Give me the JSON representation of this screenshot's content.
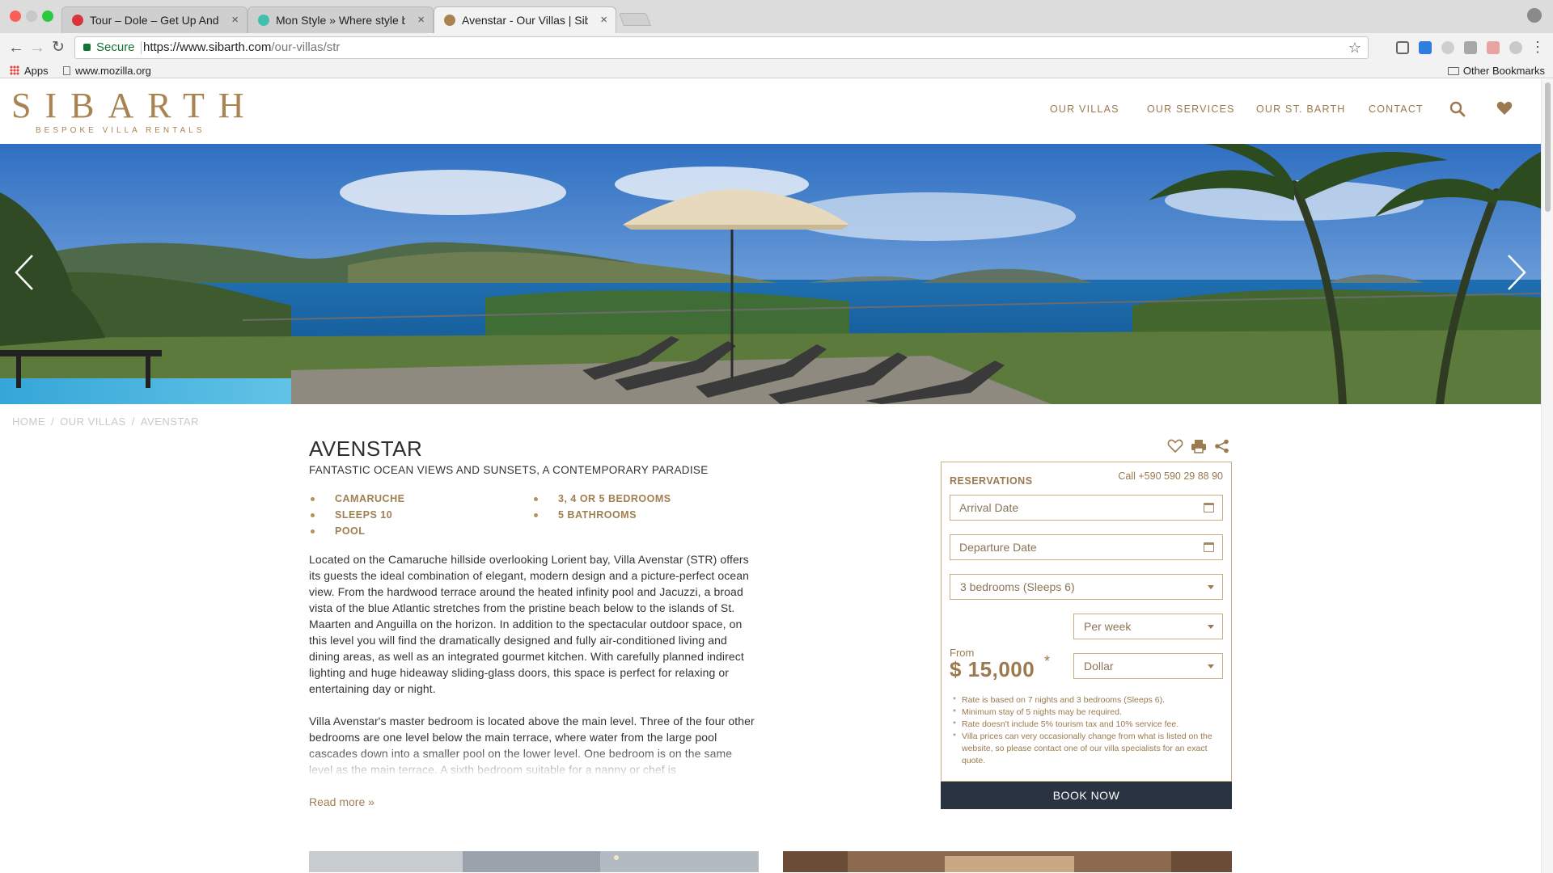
{
  "browser": {
    "tabs": [
      {
        "title": "Tour – Dole – Get Up And Grow",
        "active": false
      },
      {
        "title": "Mon Style » Where style beco",
        "active": false
      },
      {
        "title": "Avenstar - Our Villas | Sibarth",
        "active": true
      }
    ],
    "tab_close_glyph": "×",
    "secure_label": "Secure",
    "url_host": "https://www.sibarth.com",
    "url_path": "/our-villas/str",
    "bookmarks": [
      "Apps",
      "www.mozilla.org"
    ],
    "other_bookmarks": "Other Bookmarks"
  },
  "site": {
    "logo_word": "SIBARTH",
    "logo_tagline": "BESPOKE VILLA RENTALS",
    "nav": [
      "OUR VILLAS",
      "OUR SERVICES",
      "OUR ST. BARTH",
      "CONTACT"
    ],
    "accent_color": "#a07f50",
    "breadcrumb": [
      "HOME",
      "OUR VILLAS",
      "AVENSTAR"
    ],
    "breadcrumb_sep": "/"
  },
  "villa": {
    "name": "AVENSTAR",
    "tagline": "FANTASTIC OCEAN VIEWS AND SUNSETS, A CONTEMPORARY PARADISE",
    "features_left": [
      "CAMARUCHE",
      "SLEEPS 10",
      "POOL"
    ],
    "features_right": [
      "3, 4 OR 5 BEDROOMS",
      "5 BATHROOMS"
    ],
    "description": [
      "Located on the Camaruche hillside overlooking Lorient bay, Villa Avenstar (STR) offers its guests the ideal combination of elegant, modern design and a picture-perfect ocean view. From the hardwood terrace around the heated infinity pool and Jacuzzi, a broad vista of the blue Atlantic stretches from the pristine beach below to the islands of St. Maarten and Anguilla on the horizon. In addition to the spectacular outdoor space, on this level you will find the dramatically designed and fully air-conditioned living and dining areas, as well as an integrated gourmet kitchen. With carefully planned indirect lighting and huge hideaway sliding-glass doors, this space is perfect for relaxing or entertaining day or night.",
      "Villa Avenstar's master bedroom is located above the main level. Three of the four other bedrooms are one level below the main terrace, where water from the large pool cascades down into a smaller pool on the lower level. One bedroom is on the same level as the main terrace. A sixth bedroom suitable for a nanny or chef is"
    ],
    "read_more": "Read more »"
  },
  "reservation": {
    "title": "RESERVATIONS",
    "phone": "Call +590 590 29 88 90",
    "arrival_placeholder": "Arrival Date",
    "departure_placeholder": "Departure Date",
    "bedrooms_selected": "3 bedrooms (Sleeps 6)",
    "period_selected": "Per week",
    "currency_selected": "Dollar",
    "price_from_label": "From",
    "price": "$ 15,000",
    "price_asterisk": "*",
    "notes": [
      "Rate is based on 7 nights and 3 bedrooms (Sleeps 6).",
      "Minimum stay of 5 nights may be required.",
      "Rate doesn't include 5% tourism tax and 10% service fee.",
      "Villa prices can very occasionally change from what is listed on the website, so please contact one of our villa specialists for an exact quote."
    ],
    "book_now": "BOOK NOW"
  },
  "icons": {
    "search": "search-icon",
    "favorite": "heart-icon",
    "print": "print-icon",
    "share": "share-icon",
    "calendar": "calendar-icon",
    "prev": "chevron-left-icon",
    "next": "chevron-right-icon"
  }
}
